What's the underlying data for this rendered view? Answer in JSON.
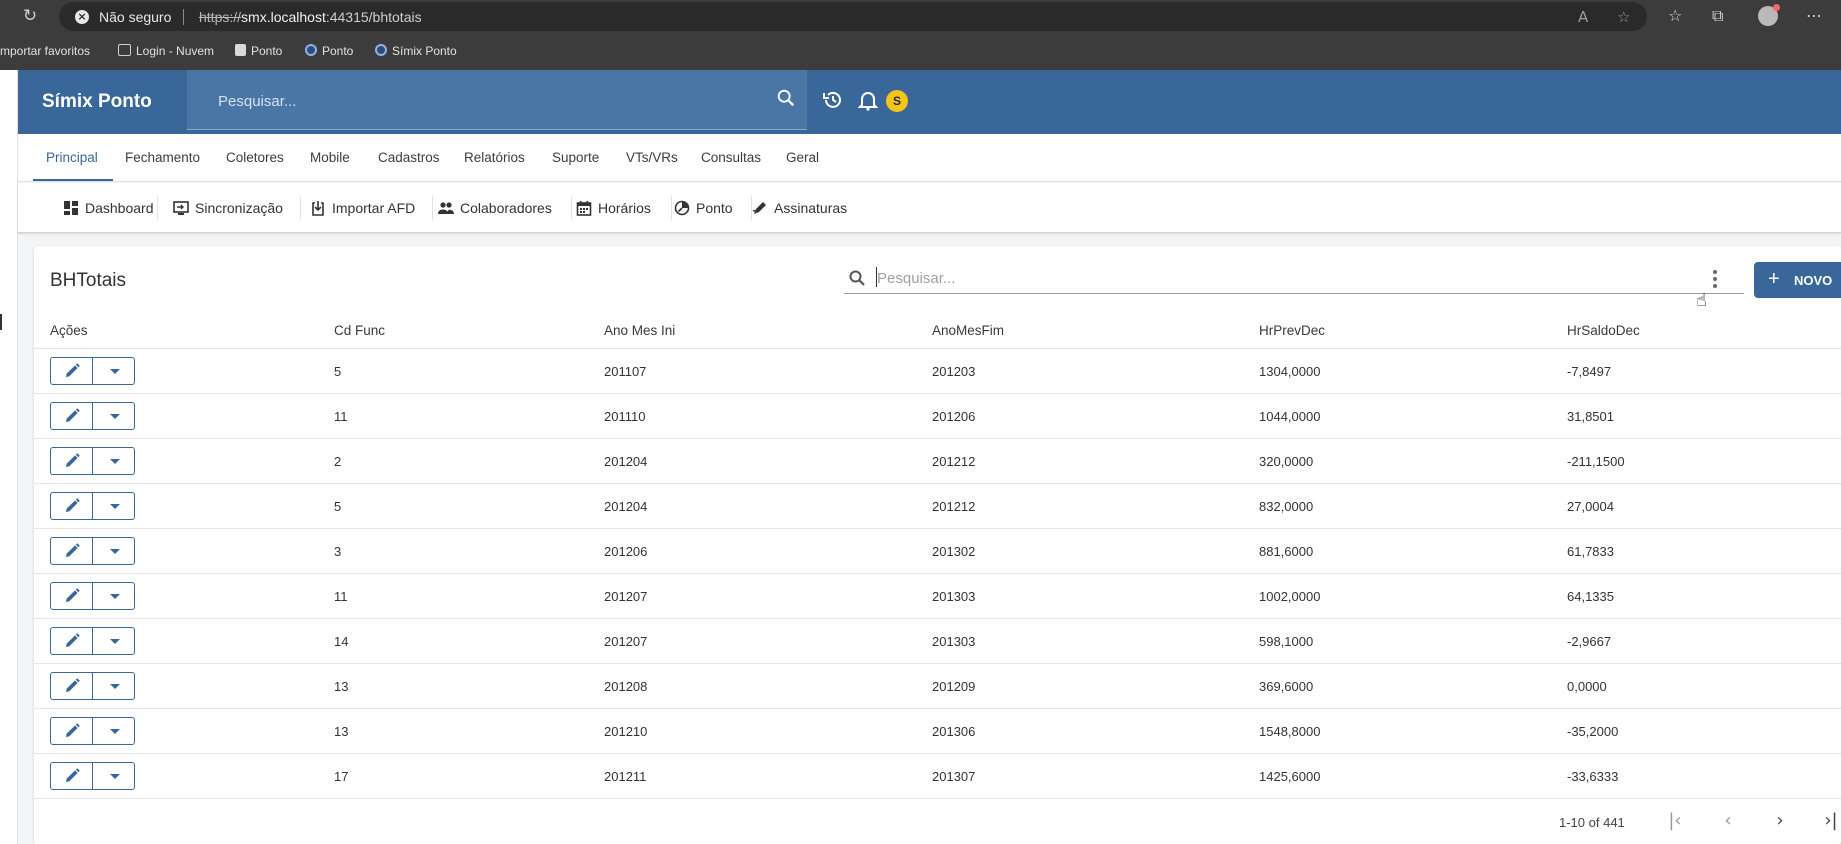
{
  "browser": {
    "security_text": "Não seguro",
    "url_scheme": "https://",
    "url_host": "smx.localhost",
    "url_rest": ":44315/bhtotais",
    "bookmarks": [
      {
        "label": "mportar favoritos",
        "icon": "none"
      },
      {
        "label": "Login - Nuvem",
        "icon": "folder-icon"
      },
      {
        "label": "Ponto",
        "icon": "page-icon"
      },
      {
        "label": "Ponto",
        "icon": "app-logo-icon"
      },
      {
        "label": "Símix Ponto",
        "icon": "app-logo-icon"
      }
    ]
  },
  "app": {
    "title": "Símix Ponto",
    "search_placeholder": "Pesquisar...",
    "user_initial": "S",
    "brand_color": "#3a6799",
    "avatar_color": "#f5c518"
  },
  "tabs": [
    {
      "label": "Principal",
      "active": true
    },
    {
      "label": "Fechamento"
    },
    {
      "label": "Coletores"
    },
    {
      "label": "Mobile"
    },
    {
      "label": "Cadastros"
    },
    {
      "label": "Relatórios"
    },
    {
      "label": "Suporte"
    },
    {
      "label": "VTs/VRs"
    },
    {
      "label": "Consultas"
    },
    {
      "label": "Geral"
    }
  ],
  "subnav": [
    {
      "label": "Dashboard",
      "icon": "dashboard-icon"
    },
    {
      "label": "Sincronização",
      "icon": "sync-icon"
    },
    {
      "label": "Importar AFD",
      "icon": "import-icon"
    },
    {
      "label": "Colaboradores",
      "icon": "people-icon"
    },
    {
      "label": "Horários",
      "icon": "calendar-icon"
    },
    {
      "label": "Ponto",
      "icon": "clock-icon"
    },
    {
      "label": "Assinaturas",
      "icon": "signature-icon"
    }
  ],
  "table": {
    "title": "BHTotais",
    "search_placeholder": "Pesquisar...",
    "new_label": "NOVO",
    "columns": [
      "Ações",
      "Cd Func",
      "Ano Mes Ini",
      "AnoMesFim",
      "HrPrevDec",
      "HrSaldoDec"
    ],
    "rows": [
      {
        "cd": "5",
        "ini": "201107",
        "fim": "201203",
        "prev": "1304,0000",
        "saldo": "-7,8497"
      },
      {
        "cd": "11",
        "ini": "201110",
        "fim": "201206",
        "prev": "1044,0000",
        "saldo": "31,8501"
      },
      {
        "cd": "2",
        "ini": "201204",
        "fim": "201212",
        "prev": "320,0000",
        "saldo": "-211,1500"
      },
      {
        "cd": "5",
        "ini": "201204",
        "fim": "201212",
        "prev": "832,0000",
        "saldo": "27,0004"
      },
      {
        "cd": "3",
        "ini": "201206",
        "fim": "201302",
        "prev": "881,6000",
        "saldo": "61,7833"
      },
      {
        "cd": "11",
        "ini": "201207",
        "fim": "201303",
        "prev": "1002,0000",
        "saldo": "64,1335"
      },
      {
        "cd": "14",
        "ini": "201207",
        "fim": "201303",
        "prev": "598,1000",
        "saldo": "-2,9667"
      },
      {
        "cd": "13",
        "ini": "201208",
        "fim": "201209",
        "prev": "369,6000",
        "saldo": "0,0000"
      },
      {
        "cd": "13",
        "ini": "201210",
        "fim": "201306",
        "prev": "1548,8000",
        "saldo": "-35,2000"
      },
      {
        "cd": "17",
        "ini": "201211",
        "fim": "201307",
        "prev": "1425,6000",
        "saldo": "-33,6333"
      }
    ],
    "pagination": "1-10 of 441"
  }
}
